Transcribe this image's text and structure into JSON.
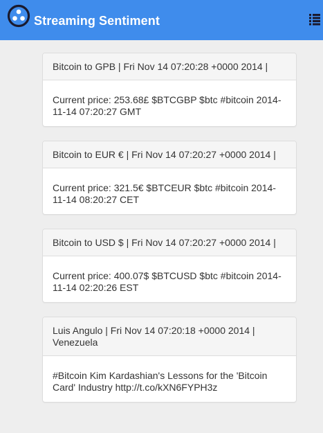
{
  "app": {
    "title": "Streaming Sentiment",
    "brand_icon": "circle-dots-icon",
    "menu_icon": "list-icon",
    "accent_color": "#3f8cec"
  },
  "feed": [
    {
      "header": "Bitcoin to GPB | Fri Nov 14 07:20:28 +0000 2014 |",
      "body": "Current price: 253.68£ $BTCGBP $btc #bitcoin 2014-11-14 07:20:27 GMT"
    },
    {
      "header": "Bitcoin to EUR € | Fri Nov 14 07:20:27 +0000 2014 |",
      "body": "Current price: 321.5€ $BTCEUR $btc #bitcoin 2014-11-14 08:20:27 CET"
    },
    {
      "header": "Bitcoin to USD $ | Fri Nov 14 07:20:27 +0000 2014 |",
      "body": "Current price: 400.07$ $BTCUSD $btc #bitcoin 2014-11-14 02:20:26 EST"
    },
    {
      "header": "Luis Angulo | Fri Nov 14 07:20:18 +0000 2014 | Venezuela",
      "body": "#Bitcoin Kim Kardashian's Lessons for the 'Bitcoin Card' Industry http://t.co/kXN6FYPH3z"
    }
  ]
}
